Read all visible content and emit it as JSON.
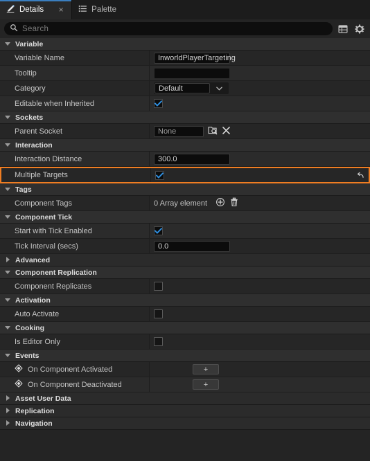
{
  "tabs": [
    {
      "label": "Details",
      "icon": "details-pencil-icon",
      "active": true,
      "close": "×"
    },
    {
      "label": "Palette",
      "icon": "palette-list-icon",
      "active": false
    }
  ],
  "search": {
    "placeholder": "Search",
    "icon": "search-icon",
    "table_view_icon": "table-view-icon",
    "settings_icon": "gear-icon"
  },
  "sections": [
    {
      "name": "Variable",
      "expanded": true,
      "rows": [
        {
          "label": "Variable Name",
          "type": "text",
          "value": "InworldPlayerTargeting"
        },
        {
          "label": "Tooltip",
          "type": "text",
          "value": ""
        },
        {
          "label": "Category",
          "type": "combo",
          "value": "Default"
        },
        {
          "label": "Editable when Inherited",
          "type": "checkbox",
          "checked": true
        }
      ]
    },
    {
      "name": "Sockets",
      "expanded": true,
      "rows": [
        {
          "label": "Parent Socket",
          "type": "socket",
          "value": "None",
          "browse_icon": "socket-browse-icon",
          "clear_icon": "clear-x-icon"
        }
      ]
    },
    {
      "name": "Interaction",
      "expanded": true,
      "rows": [
        {
          "label": "Interaction Distance",
          "type": "text",
          "value": "300.0"
        },
        {
          "label": "Multiple Targets",
          "type": "checkbox",
          "checked": true,
          "highlighted": true,
          "reset_icon": "reset-arrow-icon"
        }
      ]
    },
    {
      "name": "Tags",
      "expanded": true,
      "rows": [
        {
          "label": "Component Tags",
          "type": "array",
          "value": "0 Array element",
          "add_icon": "add-circle-icon",
          "delete_icon": "trash-icon"
        }
      ]
    },
    {
      "name": "Component Tick",
      "expanded": true,
      "rows": [
        {
          "label": "Start with Tick Enabled",
          "type": "checkbox",
          "checked": true
        },
        {
          "label": "Tick Interval (secs)",
          "type": "text",
          "value": "0.0"
        }
      ]
    },
    {
      "name": "Advanced",
      "expanded": false,
      "rows": []
    },
    {
      "name": "Component Replication",
      "expanded": true,
      "rows": [
        {
          "label": "Component Replicates",
          "type": "checkbox",
          "checked": false
        }
      ]
    },
    {
      "name": "Activation",
      "expanded": true,
      "rows": [
        {
          "label": "Auto Activate",
          "type": "checkbox",
          "checked": false
        }
      ]
    },
    {
      "name": "Cooking",
      "expanded": true,
      "rows": [
        {
          "label": "Is Editor Only",
          "type": "checkbox",
          "checked": false
        }
      ]
    },
    {
      "name": "Events",
      "expanded": true,
      "rows": [
        {
          "label": "On Component Activated",
          "type": "event",
          "button": "+",
          "icon": "event-diamond-icon"
        },
        {
          "label": "On Component Deactivated",
          "type": "event",
          "button": "+",
          "icon": "event-diamond-icon"
        }
      ]
    },
    {
      "name": "Asset User Data",
      "expanded": false,
      "rows": []
    },
    {
      "name": "Replication",
      "expanded": false,
      "rows": []
    },
    {
      "name": "Navigation",
      "expanded": false,
      "rows": []
    }
  ],
  "colors": {
    "accent_highlight": "#ef7d22",
    "tab_accent": "#3a7ebf",
    "checkbox_check": "#2f8fe0",
    "panel_bg": "#242424"
  }
}
